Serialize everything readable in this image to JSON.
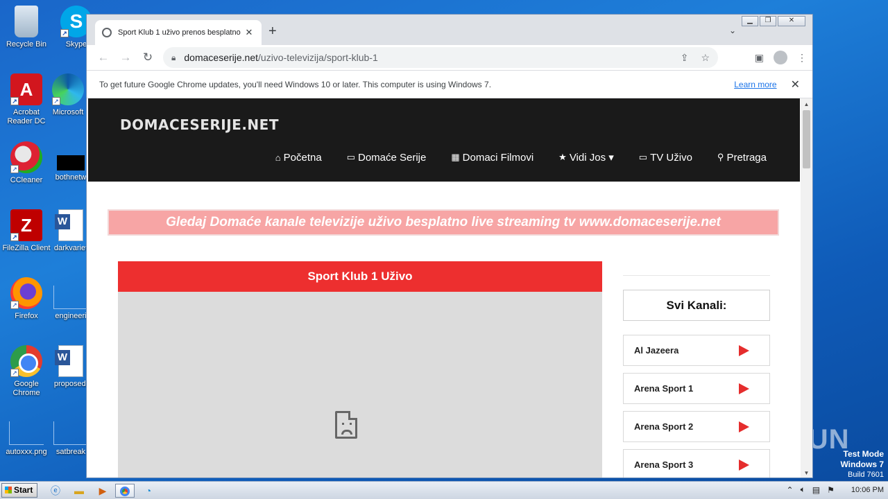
{
  "desktop": {
    "icons": [
      {
        "label": "Recycle Bin"
      },
      {
        "label": "Skype"
      },
      {
        "label": "Acrobat Reader DC"
      },
      {
        "label": "Microsoft"
      },
      {
        "label": "CCleaner"
      },
      {
        "label": "bothnetw"
      },
      {
        "label": "FileZilla Client"
      },
      {
        "label": "darkvariet"
      },
      {
        "label": "Firefox"
      },
      {
        "label": "engineeri"
      },
      {
        "label": "Google Chrome"
      },
      {
        "label": "proposedl"
      },
      {
        "label": "autoxxx.png"
      },
      {
        "label": "satbreak"
      }
    ]
  },
  "browser": {
    "tab": {
      "title": "Sport Klub 1 uživo prenos besplatno",
      "close": "✕"
    },
    "new_tab": "+",
    "tab_menu": "⌄",
    "url": {
      "host": "domaceserije.net",
      "path": "/uzivo-televizija/sport-klub-1"
    },
    "infobar": {
      "message": "To get future Google Chrome updates, you'll need Windows 10 or later. This computer is using Windows 7.",
      "learn_more": "Learn more",
      "close": "✕"
    }
  },
  "site": {
    "logo": "DOMACESERIJE.NET",
    "nav": [
      {
        "icon": "⌂",
        "label": "Početna"
      },
      {
        "icon": "▭",
        "label": "Domaće Serije"
      },
      {
        "icon": "▦",
        "label": "Domaci Filmovi"
      },
      {
        "icon": "★",
        "label": "Vidi Jos ▾"
      },
      {
        "icon": "▭",
        "label": "TV Uživo"
      },
      {
        "icon": "⚲",
        "label": "Pretraga"
      }
    ],
    "banner": "Gledaj Domaće kanale televizije uživo besplatno live streaming tv www.domaceserije.net",
    "player_title": "Sport Klub 1 Uživo",
    "sidebar_title": "Svi Kanali:",
    "channels": [
      "Al Jazeera",
      "Arena Sport 1",
      "Arena Sport 2",
      "Arena Sport 3"
    ],
    "colors": {
      "header_bg": "#1a1a1a",
      "accent_red": "#ed2f2f",
      "banner_bg": "#f7a5a5"
    }
  },
  "watermark": {
    "text": "ANY RUN"
  },
  "system": {
    "testmode_line1": "Test Mode",
    "testmode_line2": "Windows 7",
    "build": "Build 7601",
    "start_label": "Start",
    "clock": "10:06 PM"
  }
}
